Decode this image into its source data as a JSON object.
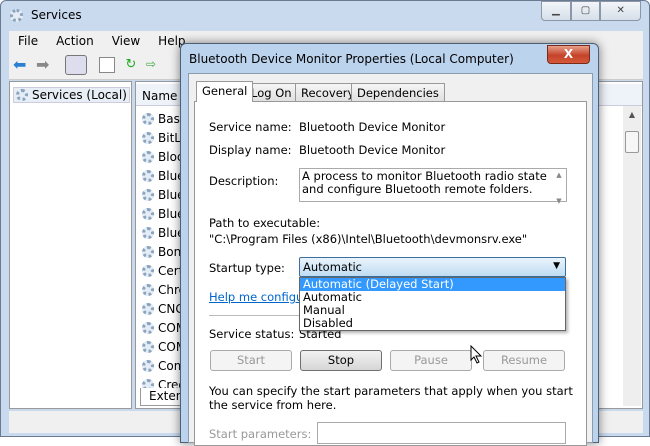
{
  "main": {
    "title": "Services",
    "menu": [
      "File",
      "Action",
      "View",
      "Help"
    ],
    "tree_item": "Services (Local)",
    "column_header": "Name",
    "rows": [
      "Base",
      "BitLo",
      "Bloc",
      "Blue",
      "Blue",
      "Blue",
      "Blue",
      "Bonj",
      "Cert",
      "Chro",
      "CNG",
      "COM",
      "COM",
      "Com",
      "Cred"
    ],
    "bottom_tab": "Extend"
  },
  "dialog": {
    "title": "Bluetooth Device Monitor Properties (Local Computer)",
    "close": "X",
    "tabs": [
      "General",
      "Log On",
      "Recovery",
      "Dependencies"
    ],
    "service_name_label": "Service name:",
    "service_name": "Bluetooth Device Monitor",
    "display_name_label": "Display name:",
    "display_name": "Bluetooth Device Monitor",
    "description_label": "Description:",
    "description": "A process to monitor Bluetooth radio state and configure Bluetooth remote folders.",
    "path_label": "Path to executable:",
    "path": "\"C:\\Program Files (x86)\\Intel\\Bluetooth\\devmonsrv.exe\"",
    "startup_label": "Startup type:",
    "startup_value": "Automatic",
    "startup_options": [
      "Automatic (Delayed Start)",
      "Automatic",
      "Manual",
      "Disabled"
    ],
    "help_link": "Help me configure s",
    "status_label": "Service status:",
    "status_value": "Started",
    "buttons": {
      "start": "Start",
      "stop": "Stop",
      "pause": "Pause",
      "resume": "Resume"
    },
    "params_note": "You can specify the start parameters that apply when you start the service from here.",
    "params_label": "Start parameters:"
  }
}
